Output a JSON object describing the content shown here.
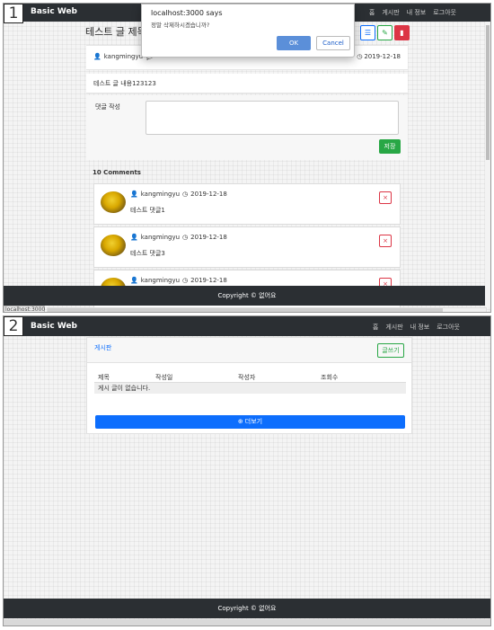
{
  "panel1": {
    "step": "1",
    "navbar": {
      "brand": "Basic Web",
      "links": [
        "홈",
        "게시판",
        "내 정보",
        "로그아웃"
      ]
    },
    "post": {
      "title": "테스트 글 제목",
      "author": "kangmingyu",
      "date": "2019-12-18",
      "body": "테스트 글 내용123123"
    },
    "comment_form": {
      "label": "댓글 작성",
      "save_label": "저장"
    },
    "comments_title": "10 Comments",
    "comments": [
      {
        "author": "kangmingyu",
        "date": "2019-12-18",
        "text": "테스트 댓글1"
      },
      {
        "author": "kangmingyu",
        "date": "2019-12-18",
        "text": "테스트 댓글3"
      },
      {
        "author": "kangmingyu",
        "date": "2019-12-18",
        "text": ""
      }
    ],
    "delete_label": "×",
    "dialog": {
      "title": "localhost:3000 says",
      "message": "정말 삭제하시겠습니까?",
      "ok": "OK",
      "cancel": "Cancel"
    },
    "footer": "Copyright © 없어요",
    "status_url": "localhost:3000"
  },
  "panel2": {
    "step": "2",
    "navbar": {
      "brand": "Basic Web",
      "links": [
        "홈",
        "게시판",
        "내 정보",
        "로그아웃"
      ]
    },
    "board": {
      "title": "게시판",
      "write_label": "글쓰기",
      "columns": [
        "제목",
        "작성일",
        "작성자",
        "조회수"
      ],
      "empty_message": "게시 글이 없습니다.",
      "more_label": "더보기"
    },
    "footer": "Copyright © 없어요"
  },
  "colors": {
    "navbar": "#2b2f33",
    "primary": "#0d6efd",
    "success": "#28a745",
    "danger": "#dc3545"
  }
}
